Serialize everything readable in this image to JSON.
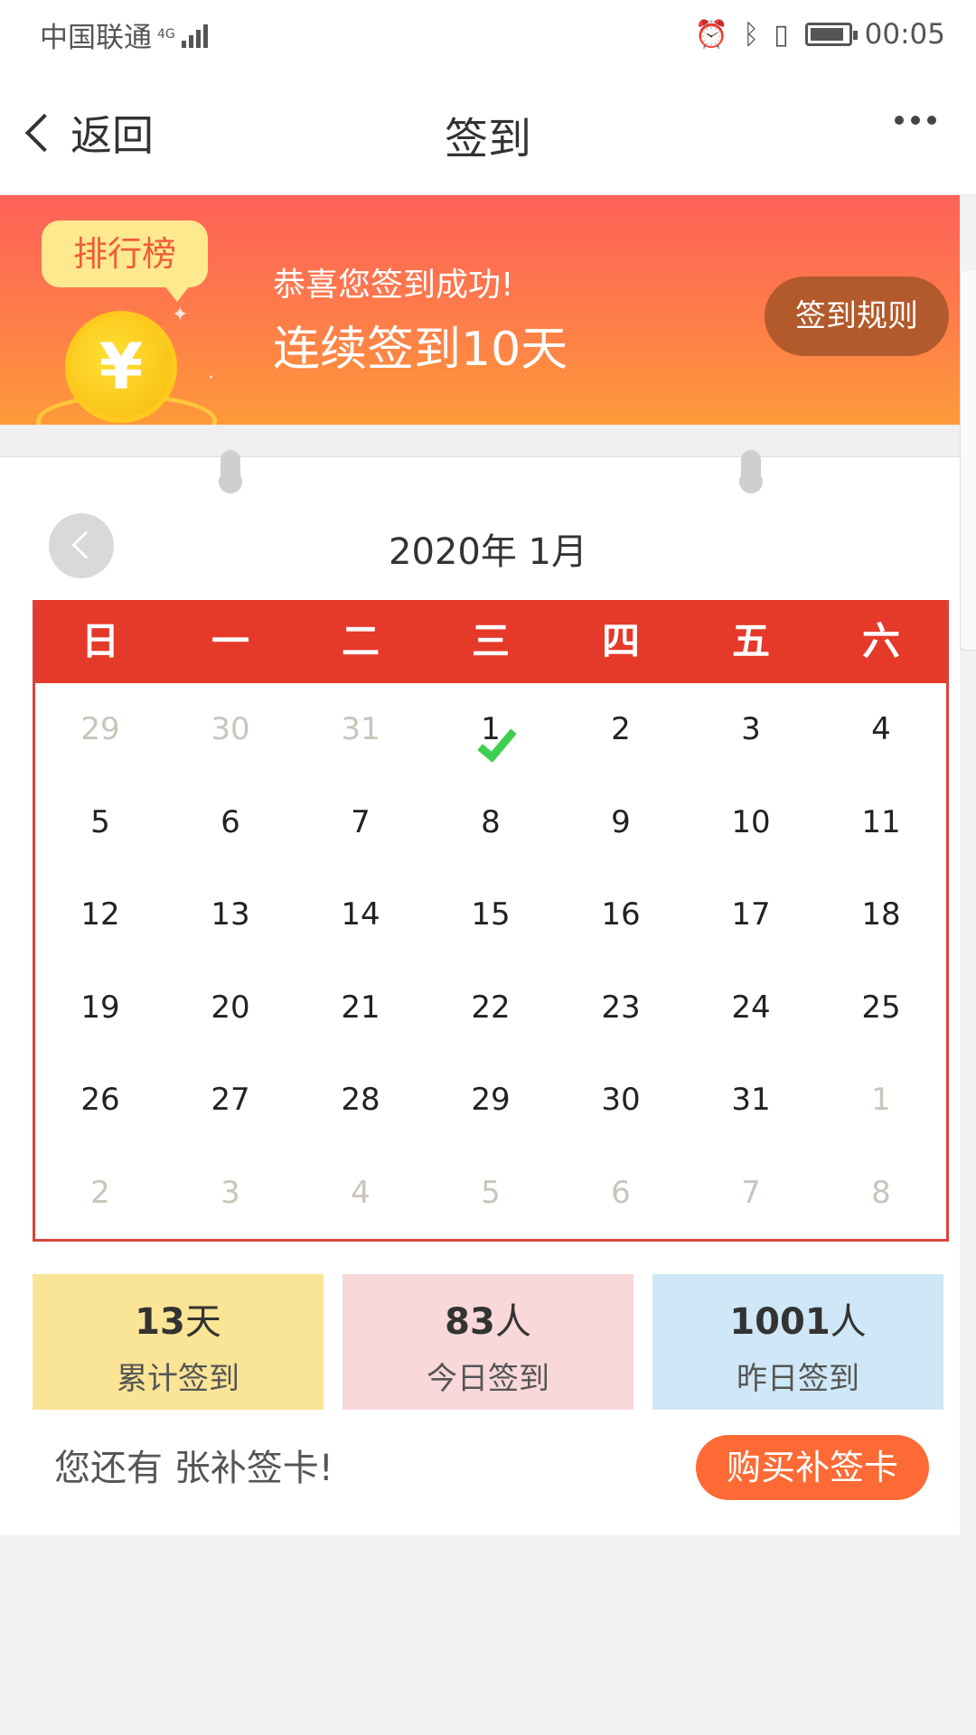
{
  "status_bar": {
    "carrier": "中国联通",
    "network": "4G",
    "time": "00:05",
    "icons": [
      "alarm-icon",
      "bluetooth-icon",
      "vibrate-icon",
      "battery-icon"
    ]
  },
  "nav": {
    "back_label": "返回",
    "title": "签到",
    "more_icon": "more-icon"
  },
  "banner": {
    "rank_label": "排行榜",
    "coin_symbol": "¥",
    "success_text": "恭喜您签到成功!",
    "streak_text": "连续签到10天",
    "rules_button": "签到规则"
  },
  "calendar": {
    "month_title": "2020年 1月",
    "weekdays": [
      "日",
      "一",
      "二",
      "三",
      "四",
      "五",
      "六"
    ],
    "weeks": [
      [
        {
          "d": "29",
          "m": true
        },
        {
          "d": "30",
          "m": true
        },
        {
          "d": "31",
          "m": true
        },
        {
          "d": "1",
          "m": false,
          "checked": true
        },
        {
          "d": "2",
          "m": false
        },
        {
          "d": "3",
          "m": false
        },
        {
          "d": "4",
          "m": false
        }
      ],
      [
        {
          "d": "5",
          "m": false
        },
        {
          "d": "6",
          "m": false
        },
        {
          "d": "7",
          "m": false
        },
        {
          "d": "8",
          "m": false
        },
        {
          "d": "9",
          "m": false
        },
        {
          "d": "10",
          "m": false
        },
        {
          "d": "11",
          "m": false
        }
      ],
      [
        {
          "d": "12",
          "m": false
        },
        {
          "d": "13",
          "m": false
        },
        {
          "d": "14",
          "m": false
        },
        {
          "d": "15",
          "m": false
        },
        {
          "d": "16",
          "m": false
        },
        {
          "d": "17",
          "m": false
        },
        {
          "d": "18",
          "m": false
        }
      ],
      [
        {
          "d": "19",
          "m": false
        },
        {
          "d": "20",
          "m": false
        },
        {
          "d": "21",
          "m": false
        },
        {
          "d": "22",
          "m": false
        },
        {
          "d": "23",
          "m": false
        },
        {
          "d": "24",
          "m": false
        },
        {
          "d": "25",
          "m": false
        }
      ],
      [
        {
          "d": "26",
          "m": false
        },
        {
          "d": "27",
          "m": false
        },
        {
          "d": "28",
          "m": false
        },
        {
          "d": "29",
          "m": false
        },
        {
          "d": "30",
          "m": false
        },
        {
          "d": "31",
          "m": false
        },
        {
          "d": "1",
          "m": true
        }
      ],
      [
        {
          "d": "2",
          "m": true
        },
        {
          "d": "3",
          "m": true
        },
        {
          "d": "4",
          "m": true
        },
        {
          "d": "5",
          "m": true
        },
        {
          "d": "6",
          "m": true
        },
        {
          "d": "7",
          "m": true
        },
        {
          "d": "8",
          "m": true
        }
      ]
    ]
  },
  "stats": [
    {
      "value": "13",
      "unit": "天",
      "label": "累计签到",
      "color": "#fae496"
    },
    {
      "value": "83",
      "unit": "人",
      "label": "今日签到",
      "color": "#f8d8d9"
    },
    {
      "value": "1001",
      "unit": "人",
      "label": "昨日签到",
      "color": "#cfe7f6"
    }
  ],
  "makeup": {
    "text": "您还有 张补签卡!",
    "buy_button": "购买补签卡"
  },
  "colors": {
    "accent_red": "#e5392a",
    "banner_top": "#fe6259",
    "banner_bottom": "#fe9a3a",
    "check_green": "#3ecf52",
    "buy_button": "#fd6a35"
  }
}
